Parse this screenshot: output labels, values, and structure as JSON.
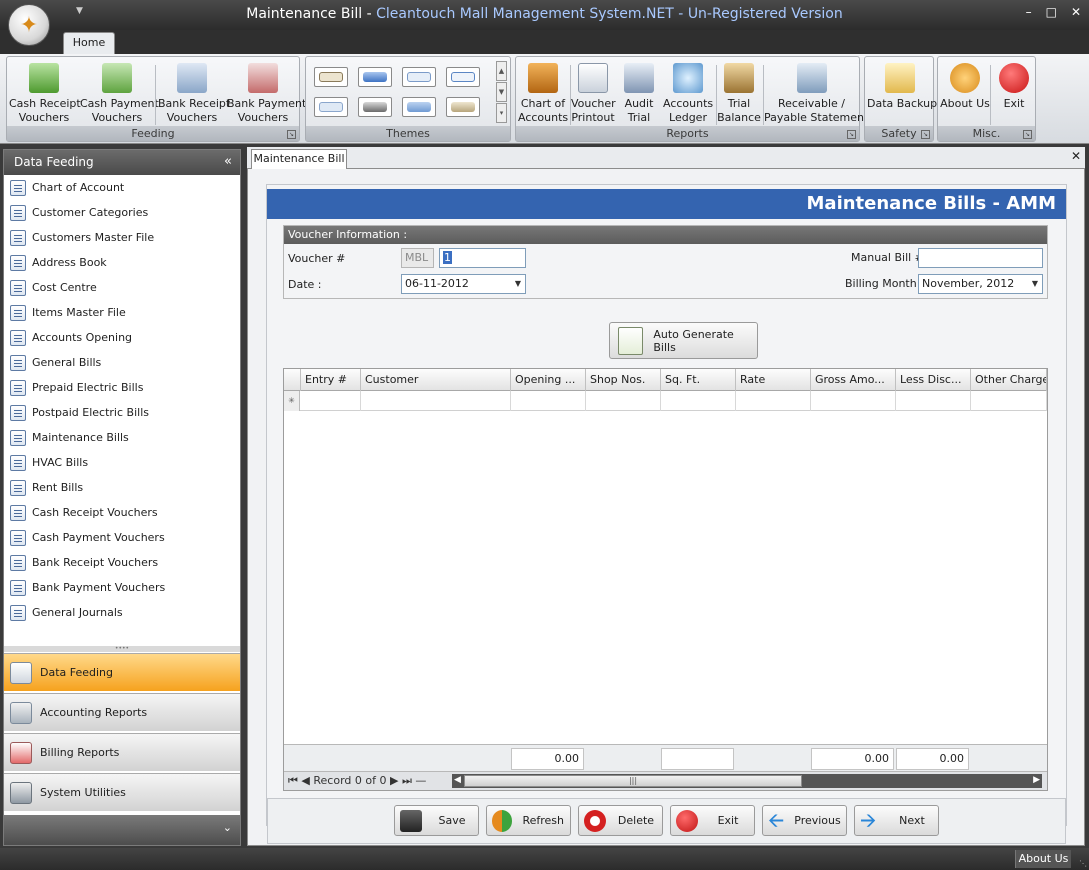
{
  "window": {
    "title_main": "Maintenance Bill - ",
    "title_app": "Cleantouch Mall Management System.NET - Un-Registered Version",
    "controls": [
      "–",
      "□",
      "✕"
    ]
  },
  "ribbon": {
    "tab": "Home",
    "groups": {
      "feeding": {
        "label": "Feeding",
        "buttons": [
          "Cash Receipt\nVouchers",
          "Cash Payment\nVouchers",
          "Bank Receipt\nVouchers",
          "Bank Payment\nVouchers"
        ]
      },
      "themes": {
        "label": "Themes"
      },
      "reports": {
        "label": "Reports",
        "buttons": [
          "Chart of\nAccounts",
          "Voucher\nPrintout",
          "Audit\nTrial",
          "Accounts\nLedger",
          "Trial\nBalance",
          "Receivable /\nPayable Statement"
        ]
      },
      "safety": {
        "label": "Safety",
        "buttons": [
          "Data Backup"
        ]
      },
      "misc": {
        "label": "Misc.",
        "buttons": [
          "About Us",
          "Exit"
        ]
      }
    }
  },
  "nav": {
    "header": "Data Feeding",
    "collapse": "«",
    "items": [
      "Chart of Account",
      "Customer Categories",
      "Customers Master File",
      "Address Book",
      "Cost Centre",
      "Items Master File",
      "Accounts Opening",
      "General Bills",
      "Prepaid Electric Bills",
      "Postpaid Electric Bills",
      "Maintenance Bills",
      "HVAC Bills",
      "Rent Bills",
      "Cash Receipt Vouchers",
      "Cash Payment Vouchers",
      "Bank Receipt Vouchers",
      "Bank Payment Vouchers",
      "General Journals"
    ],
    "sections": [
      "Data Feeding",
      "Accounting Reports",
      "Billing Reports",
      "System Utilities"
    ],
    "footer_chevron": "⌄"
  },
  "document": {
    "tab": "Maintenance Bill",
    "close": "✕",
    "banner": "Maintenance Bills - AMM",
    "voucher_info": {
      "header": "Voucher Information :",
      "voucher_label": "Voucher #",
      "voucher_prefix": "MBL",
      "voucher_number": "1",
      "date_label": "Date :",
      "date_value": "06-11-2012",
      "manual_bill_label": "Manual Bill #",
      "manual_bill_value": "",
      "billing_month_label": "Billing Month :",
      "billing_month_value": "November, 2012"
    },
    "auto_generate": "Auto Generate Bills",
    "grid": {
      "columns": [
        "Entry #",
        "Customer",
        "Opening ...",
        "Shop Nos.",
        "Sq. Ft.",
        "Rate",
        "Gross Amo...",
        "Less Disc...",
        "Other Charge..."
      ],
      "new_row_marker": "✳",
      "totals": [
        "0.00",
        "",
        "0.00",
        "0.00"
      ],
      "record_text": "Record 0 of 0",
      "thumb_grip": "|||"
    },
    "actions": [
      "Save",
      "Refresh",
      "Delete",
      "Exit",
      "Previous",
      "Next"
    ]
  },
  "status": {
    "about": "About Us"
  }
}
